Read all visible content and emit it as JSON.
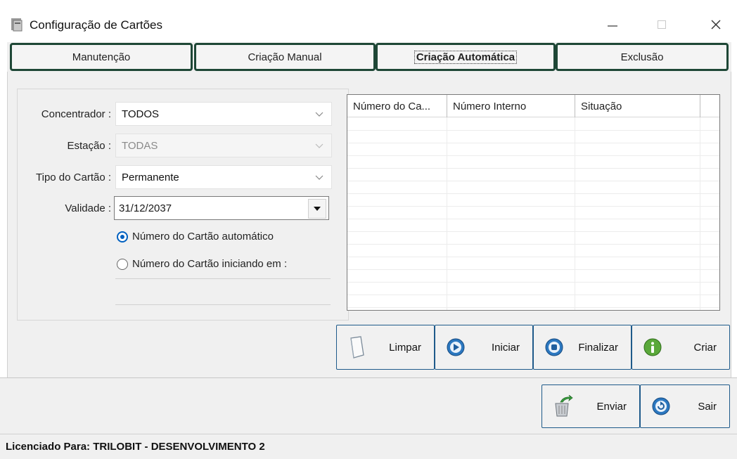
{
  "window": {
    "title": "Configuração de Cartões",
    "icon": "card-app-icon"
  },
  "tabs": [
    {
      "label": "Manutenção",
      "active": false
    },
    {
      "label": "Criação Manual",
      "active": false
    },
    {
      "label": "Criação Automática",
      "active": true
    },
    {
      "label": "Exclusão",
      "active": false
    }
  ],
  "form": {
    "concentrador": {
      "label": "Concentrador :",
      "value": "TODOS"
    },
    "estacao": {
      "label": "Estação :",
      "value": "TODAS",
      "disabled": true
    },
    "tipo": {
      "label": "Tipo do Cartão :",
      "value": "Permanente"
    },
    "validade": {
      "label": "Validade :",
      "value": "31/12/2037"
    },
    "radio_auto": {
      "label": "Número do Cartão automático",
      "checked": true
    },
    "radio_start": {
      "label": "Número do Cartão iniciando em :",
      "checked": false
    }
  },
  "grid": {
    "columns": [
      "Número do Ca...",
      "Número Interno",
      "Situação"
    ]
  },
  "actions": {
    "limpar": "Limpar",
    "iniciar": "Iniciar",
    "finalizar": "Finalizar",
    "criar": "Criar"
  },
  "footer_actions": {
    "enviar": "Enviar",
    "sair": "Sair"
  },
  "status": {
    "license": "Licenciado Para: TRILOBIT - DESENVOLVIMENTO 2"
  },
  "colors": {
    "tab_border": "#1e4736",
    "button_border": "#1e5a8a",
    "radio_accent": "#0060c0"
  }
}
